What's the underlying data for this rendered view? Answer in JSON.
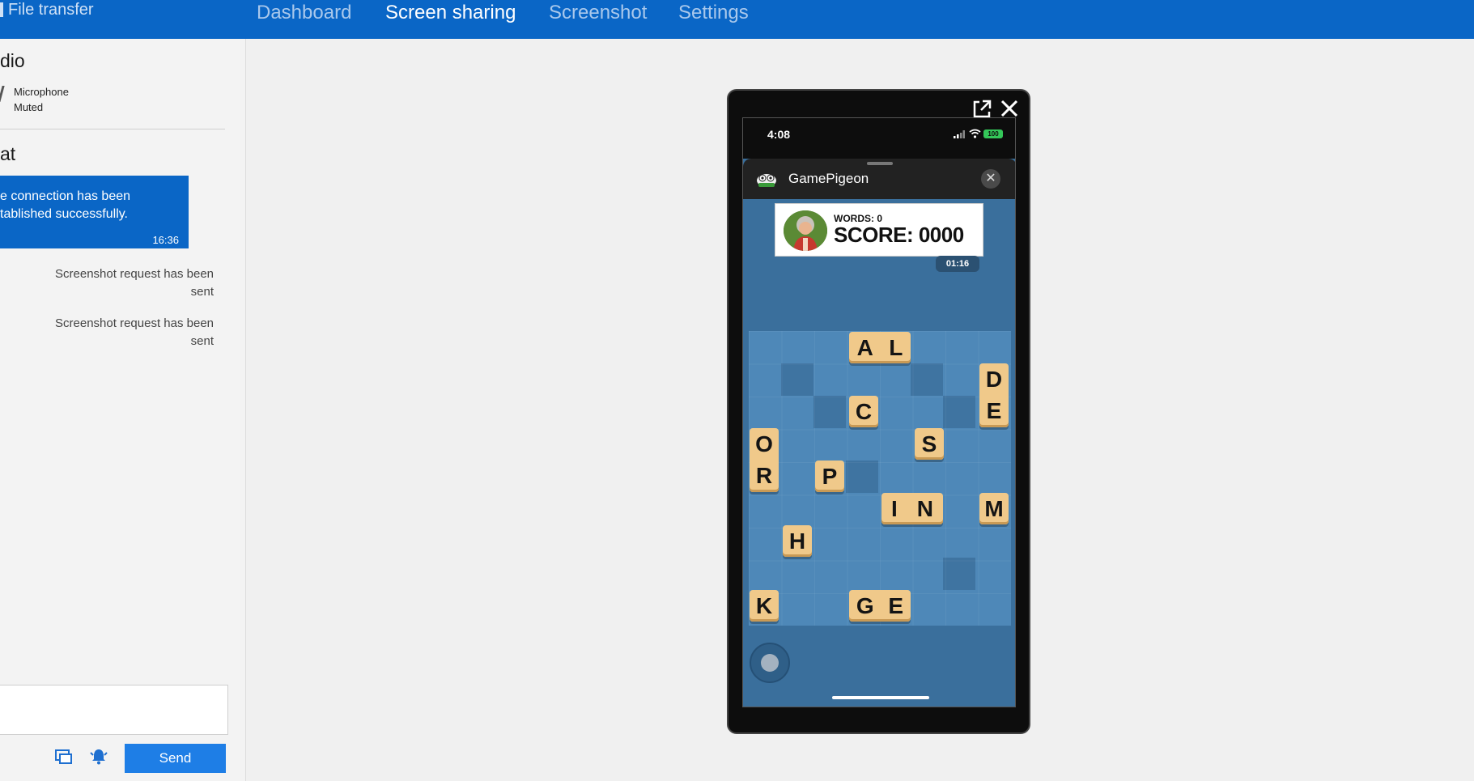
{
  "header": {
    "file_transfer": "File transfer",
    "tabs": [
      {
        "label": "Dashboard",
        "active": false
      },
      {
        "label": "Screen sharing",
        "active": true
      },
      {
        "label": "Screenshot",
        "active": false
      },
      {
        "label": "Settings",
        "active": false
      }
    ],
    "accent_color": "#0a66c6"
  },
  "left_panel": {
    "audio_title": "dio",
    "microphone": {
      "label": "Microphone",
      "status": "Muted"
    },
    "chat_title": "at",
    "messages": [
      {
        "type": "incoming",
        "text": "e connection has been tablished successfully.",
        "time": "16:36"
      },
      {
        "type": "system",
        "text": "Screenshot request has been sent"
      },
      {
        "type": "system",
        "text": "Screenshot request has been sent"
      }
    ],
    "chat_input": {
      "value": "",
      "placeholder": ""
    },
    "send_label": "Send",
    "icons": [
      "screenshot-icon",
      "notification-bell-icon"
    ]
  },
  "phone": {
    "status": {
      "time": "4:08",
      "battery": "100"
    },
    "app": {
      "name": "GamePigeon",
      "close_symbol": "✕"
    },
    "game": {
      "words_label": "WORDS: 0",
      "score_label": "SCORE: 0000",
      "timer": "01:16",
      "tiles": [
        {
          "letters": [
            "A",
            "L"
          ]
        },
        {
          "letters": [
            "D",
            "E"
          ]
        },
        {
          "letters": [
            "C"
          ]
        },
        {
          "letters": [
            "O",
            "R"
          ]
        },
        {
          "letters": [
            "S"
          ]
        },
        {
          "letters": [
            "P"
          ]
        },
        {
          "letters": [
            "I",
            "N"
          ]
        },
        {
          "letters": [
            "M"
          ]
        },
        {
          "letters": [
            "H"
          ]
        },
        {
          "letters": [
            "K"
          ]
        },
        {
          "letters": [
            "G",
            "E"
          ]
        }
      ]
    }
  }
}
